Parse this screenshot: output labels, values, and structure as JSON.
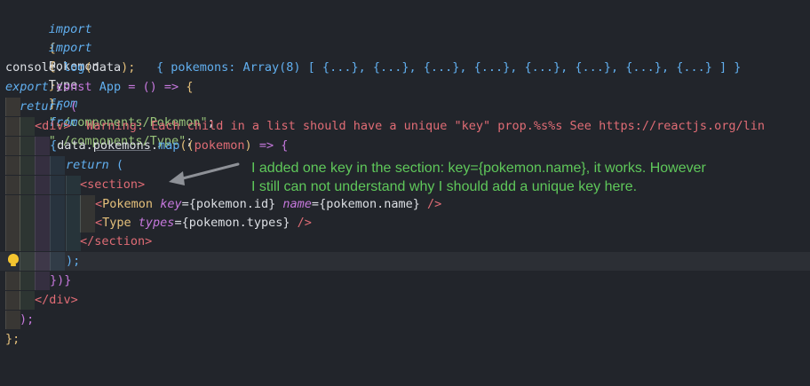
{
  "lines": [
    {
      "t": "import",
      "a": "{",
      "b": "Pokemon",
      "c": "}",
      "d": "from",
      "e": "\"./components/Pokemon\"",
      "f": ";"
    },
    {
      "t": "import",
      "a": "{",
      "b": "Type",
      "c": "}",
      "d": "from",
      "e": "\"./components/Type\"",
      "f": ";"
    }
  ],
  "console_line": {
    "obj": "console",
    "dot": ".",
    "method": "log",
    "open": "(",
    "arg": "data",
    "close": ");",
    "inline_result": "{ pokemons: Array(8) [ {...}, {...}, {...}, {...}, {...}, {...}, {...}, {...} ] }"
  },
  "app_line": {
    "export": "export",
    "const": "const",
    "name": "App",
    "eq": "=",
    "parens": "()",
    "arrow": "=>",
    "brace": "{"
  },
  "return_outer": {
    "kw": "return",
    "paren": "("
  },
  "div_open": {
    "tag": "<div>",
    "warning": "Warning: Each child in a list should have a unique \"key\" prop.%s%s See https://reactjs.org/lin"
  },
  "map_line": {
    "open": "{",
    "data": "data",
    "dot1": ".",
    "pokemons": "pokemons",
    "dot2": ".",
    "map": "map",
    "p1": "((",
    "param": "pokemon",
    "p2": ")",
    "arrow": "=>",
    "brace": "{"
  },
  "return_inner": {
    "kw": "return",
    "paren": "("
  },
  "section_open": "<section>",
  "pokemon_line": {
    "lt": "<",
    "comp": "Pokemon",
    "attr1": "key",
    "eq1": "=",
    "v1": "{pokemon.id}",
    "attr2": "name",
    "eq2": "=",
    "v2": "{pokemon.name}",
    "end": "/>"
  },
  "type_line": {
    "lt": "<",
    "comp": "Type",
    "attr": "types",
    "eq": "=",
    "v": "{pokemon.types}",
    "end": "/>"
  },
  "section_close": "</section>",
  "paren_semi": ");",
  "map_close": "})}",
  "div_close": "</div>",
  "outer_close": ");",
  "app_close": "};",
  "annotation": {
    "line1": "I added one key in the section: key={pokemon.name}, it works. However",
    "line2": "I still can not understand why I should add a unique key here."
  },
  "colors": {
    "background": "#22252b",
    "annotation": "#5fc85a",
    "keyword": "#61afef",
    "string": "#98c379",
    "tag": "#e06c75",
    "component": "#e5c07b",
    "attribute": "#c678dd"
  },
  "icons": [
    "lightbulb-icon",
    "arrow-icon"
  ]
}
